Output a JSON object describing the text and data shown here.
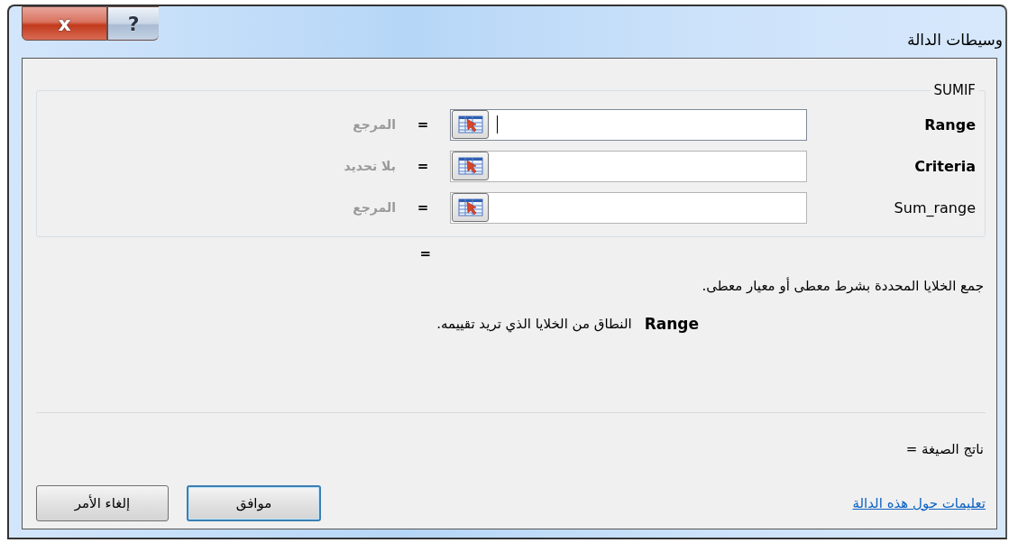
{
  "window": {
    "title": "وسيطات الدالة"
  },
  "title_buttons": [
    {
      "kind": "help",
      "symbol": "?"
    },
    {
      "kind": "close",
      "symbol": "x"
    }
  ],
  "function_name": "SUMIF",
  "arguments": [
    {
      "name": "Range",
      "required": true,
      "focused": true,
      "equals": "=",
      "result": "المرجع"
    },
    {
      "name": "Criteria",
      "required": true,
      "focused": false,
      "equals": "=",
      "result": "بلا تحديد"
    },
    {
      "name": "Sum_range",
      "required": false,
      "focused": false,
      "equals": "=",
      "result": "المرجع"
    }
  ],
  "function_result_equals": "=",
  "description": "جمع الخلايا المحددة بشرط معطى أو معيار معطى.",
  "argument_help": {
    "name": "Range",
    "text": "النطاق من الخلايا الذي تريد تقييمه."
  },
  "formula_result": "ناتج الصيغة =",
  "help_link": "تعليمات حول هذه الدالة",
  "buttons": [
    {
      "label": "موافق",
      "default": true
    },
    {
      "label": "إلغاء الأمر",
      "default": false
    }
  ]
}
